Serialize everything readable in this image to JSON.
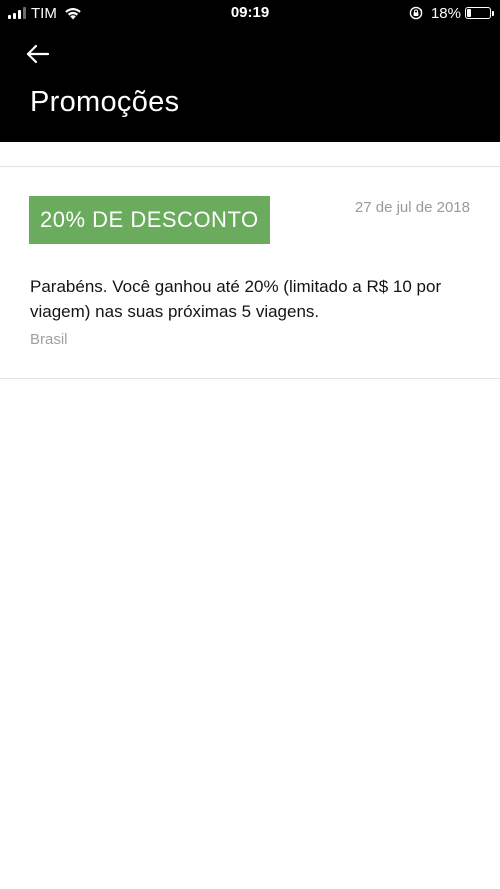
{
  "status_bar": {
    "carrier": "TIM",
    "time": "09:19",
    "battery_percent": "18%",
    "battery_level": 0.18,
    "signal_bars": 3,
    "icons": [
      "signal-icon",
      "wifi-icon",
      "rotation-lock-icon",
      "battery-icon"
    ]
  },
  "header": {
    "back_icon": "arrow-left-icon",
    "title": "Promoções",
    "background_color": "#000000"
  },
  "promotions": [
    {
      "badge": "20% DE DESCONTO",
      "badge_color": "#6aab5e",
      "date": "27 de jul de 2018",
      "description": "Parabéns. Você ganhou até 20% (limitado a R$ 10 por viagem) nas suas próximas 5 viagens.",
      "region": "Brasil"
    }
  ]
}
